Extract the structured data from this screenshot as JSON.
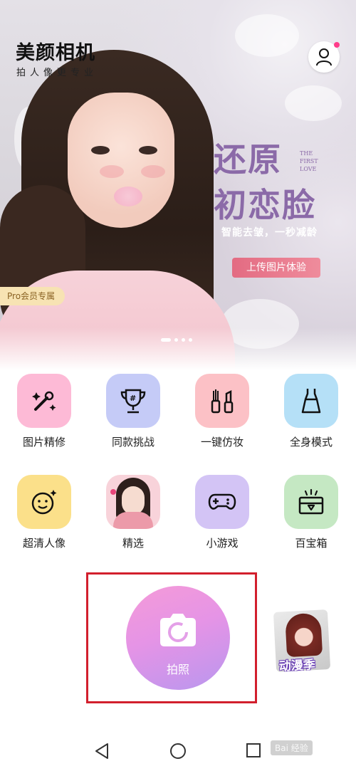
{
  "header": {
    "app_title": "美颜相机",
    "app_subtitle": "拍人像更专业"
  },
  "banner": {
    "promo_line1": "还原",
    "promo_line2": "初恋脸",
    "english_text": "THE FIRST LOVE",
    "tagline": "智能去皱，一秒减龄",
    "upload_button": "上传图片体验",
    "pro_badge": "Pro会员专属",
    "carousel": {
      "count": 4,
      "active_index": 0
    }
  },
  "features": [
    {
      "label": "图片精修",
      "icon": "magic-wand-icon",
      "bg": "#fdbad6"
    },
    {
      "label": "同款挑战",
      "icon": "trophy-icon",
      "bg": "#c5cbf7"
    },
    {
      "label": "一键仿妆",
      "icon": "makeup-icon",
      "bg": "#fcc1c6"
    },
    {
      "label": "全身模式",
      "icon": "dress-icon",
      "bg": "#b5e0f7"
    },
    {
      "label": "超清人像",
      "icon": "face-icon",
      "bg": "#fbe08a"
    },
    {
      "label": "精选",
      "icon": "featured-photo",
      "bg": "#f8d3da"
    },
    {
      "label": "小游戏",
      "icon": "gamepad-icon",
      "bg": "#d3c4f5"
    },
    {
      "label": "百宝箱",
      "icon": "treasure-box-icon",
      "bg": "#c5e8c3"
    }
  ],
  "shoot": {
    "label": "拍照"
  },
  "anime_promo": {
    "label": "动漫季"
  },
  "watermark": "Bai 经验",
  "colors": {
    "accent_purple": "#8b6aa8",
    "highlight_red": "#d21f2d"
  }
}
